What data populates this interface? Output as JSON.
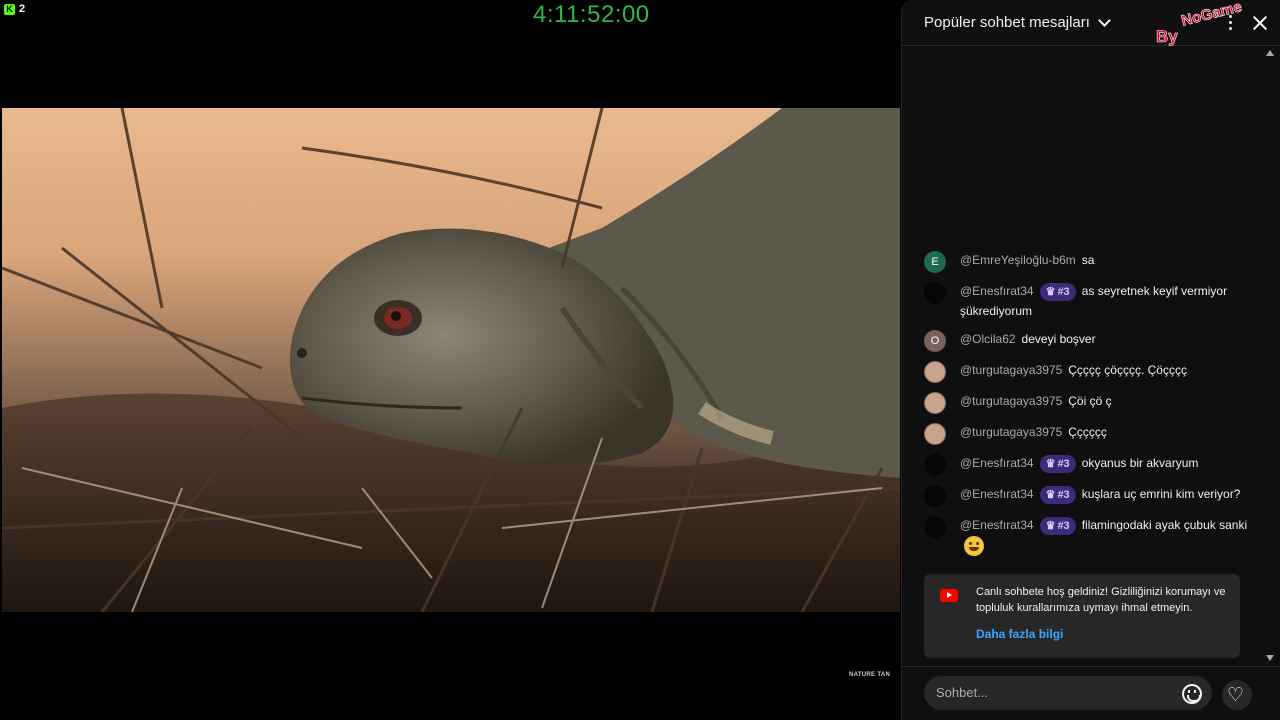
{
  "overlay": {
    "kick_count": "2",
    "timer": "4:11:52:00"
  },
  "video": {
    "watermark": "NATURE TAN"
  },
  "chat": {
    "title": "Popüler sohbet mesajları",
    "logo_text": "NoGame By",
    "messages": [
      {
        "initial": "E",
        "user": "@EmreYeşiloğlu-b6m",
        "rank": "",
        "text": "sa"
      },
      {
        "initial": "",
        "user": "@Enesfırat34",
        "rank": "#3",
        "text": "as seyretnek keyif vermiyor şükrediyorum"
      },
      {
        "initial": "O",
        "user": "@Olcila62",
        "rank": "",
        "text": "deveyi boşver"
      },
      {
        "initial": "",
        "user": "@turgutagaya3975",
        "rank": "",
        "text": "Ççççç çöçççç. Çöçççç"
      },
      {
        "initial": "",
        "user": "@turgutagaya3975",
        "rank": "",
        "text": "Çöi çö ç"
      },
      {
        "initial": "",
        "user": "@turgutagaya3975",
        "rank": "",
        "text": "Çççççç"
      },
      {
        "initial": "",
        "user": "@Enesfırat34",
        "rank": "#3",
        "text": "okyanus bir akvaryum"
      },
      {
        "initial": "",
        "user": "@Enesfırat34",
        "rank": "#3",
        "text": "kuşlara uç emrini kim veriyor?"
      },
      {
        "initial": "",
        "user": "@Enesfırat34",
        "rank": "#3",
        "text": "filamingodaki ayak çubuk sanki"
      }
    ],
    "welcome": {
      "text": "Canlı sohbete hoş geldiniz! Gizliliğinizi korumayı ve topluluk kurallarımıza uymayı ihmal etmeyin.",
      "link": "Daha fazla bilgi"
    },
    "input_placeholder": "Sohbet..."
  },
  "icons": {
    "close": "close-icon",
    "menu": "more-vert-icon",
    "emoji": "emoji-icon",
    "heart": "heart-icon",
    "youtube": "youtube-icon"
  }
}
